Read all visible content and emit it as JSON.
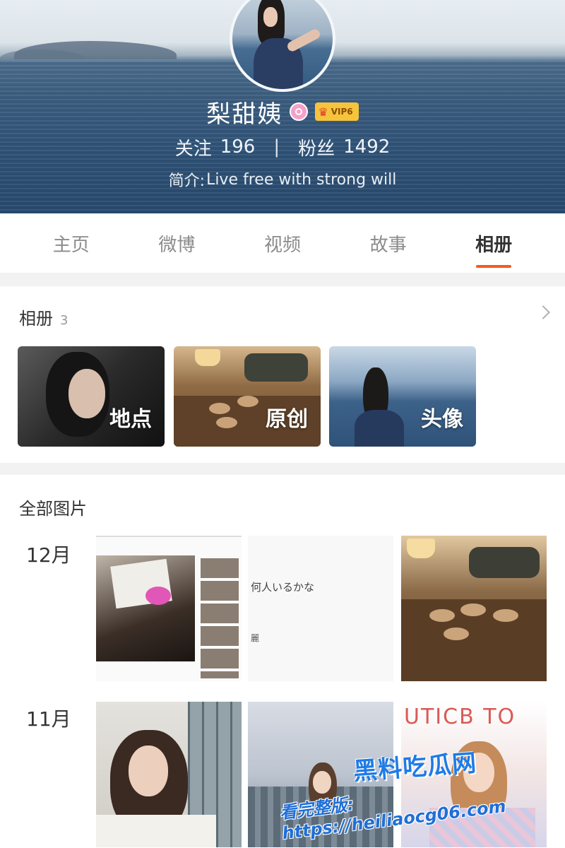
{
  "profile": {
    "name": "梨甜姨",
    "vip_label": "VIP6",
    "following_label": "关注",
    "following_count": "196",
    "separator": "|",
    "followers_label": "粉丝",
    "followers_count": "1492",
    "bio_prefix": "简介:",
    "bio_text": "Live free with strong will"
  },
  "tabs": [
    {
      "label": "主页",
      "active": false
    },
    {
      "label": "微博",
      "active": false
    },
    {
      "label": "视频",
      "active": false
    },
    {
      "label": "故事",
      "active": false
    },
    {
      "label": "相册",
      "active": true
    }
  ],
  "albums": {
    "title": "相册",
    "count": "3",
    "items": [
      {
        "label": "地点"
      },
      {
        "label": "原创"
      },
      {
        "label": "头像"
      }
    ]
  },
  "all_photos": {
    "title": "全部图片",
    "groups": [
      {
        "month": "12月",
        "photo_text_1": "何人いるかな",
        "photo_text_2": "麗"
      },
      {
        "month": "11月",
        "photo_text_sign": "UTICB TO"
      }
    ]
  },
  "watermark": {
    "title": "黑料吃瓜网",
    "url": "看完整版: https://heiliaocg06.com"
  },
  "colors": {
    "accent": "#f25c1f",
    "vip_gold": "#f5c43c",
    "watermark_blue": "#1f7be6"
  }
}
